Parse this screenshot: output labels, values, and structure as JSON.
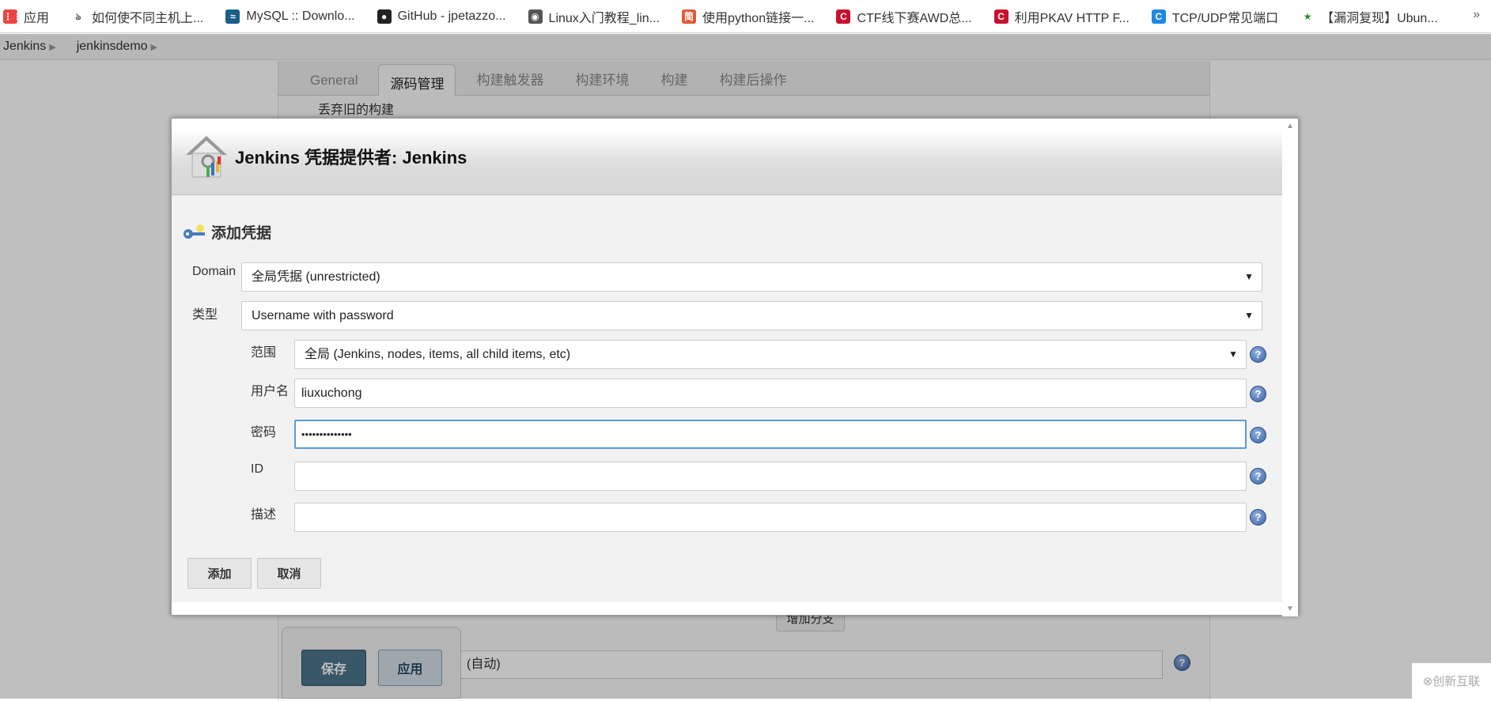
{
  "bookmarks": [
    {
      "label": "应用",
      "icon": "apps-grid-icon"
    },
    {
      "label": "如何使不同主机上...",
      "icon": "paw-icon"
    },
    {
      "label": "MySQL :: Downlo...",
      "icon": "mysql-icon"
    },
    {
      "label": "GitHub - jpetazzo...",
      "icon": "github-icon"
    },
    {
      "label": "Linux入门教程_lin...",
      "icon": "globe-icon"
    },
    {
      "label": "使用python链接一...",
      "icon": "jian-icon"
    },
    {
      "label": "CTF线下赛AWD总...",
      "icon": "c-red-icon"
    },
    {
      "label": "利用PKAV HTTP F...",
      "icon": "c-red-icon"
    },
    {
      "label": "TCP/UDP常见端口",
      "icon": "c-blue-icon"
    },
    {
      "label": "【漏洞复现】Ubun...",
      "icon": "star-icon"
    }
  ],
  "bookmarks_more": "»",
  "breadcrumb": [
    "Jenkins",
    "jenkinsdemo"
  ],
  "tabs": [
    "General",
    "源码管理",
    "构建触发器",
    "构建环境",
    "构建",
    "构建后操作"
  ],
  "active_tab": "源码管理",
  "background": {
    "discard_old": "丢弃旧的构建",
    "add_branch": "增加分支",
    "browser_select": "(自动)",
    "save": "保存",
    "apply": "应用"
  },
  "dialog": {
    "title": "Jenkins 凭据提供者: Jenkins",
    "section": "添加凭据",
    "domain_label": "Domain",
    "domain_value": "全局凭据 (unrestricted)",
    "kind_label": "类型",
    "kind_value": "Username with password",
    "scope_label": "范围",
    "scope_value": "全局 (Jenkins, nodes, items, all child items, etc)",
    "username_label": "用户名",
    "username_value": "liuxuchong",
    "password_label": "密码",
    "password_value": "••••••••••••••",
    "id_label": "ID",
    "id_value": "",
    "desc_label": "描述",
    "desc_value": "",
    "add_button": "添加",
    "cancel_button": "取消"
  },
  "watermark": "创新互联"
}
